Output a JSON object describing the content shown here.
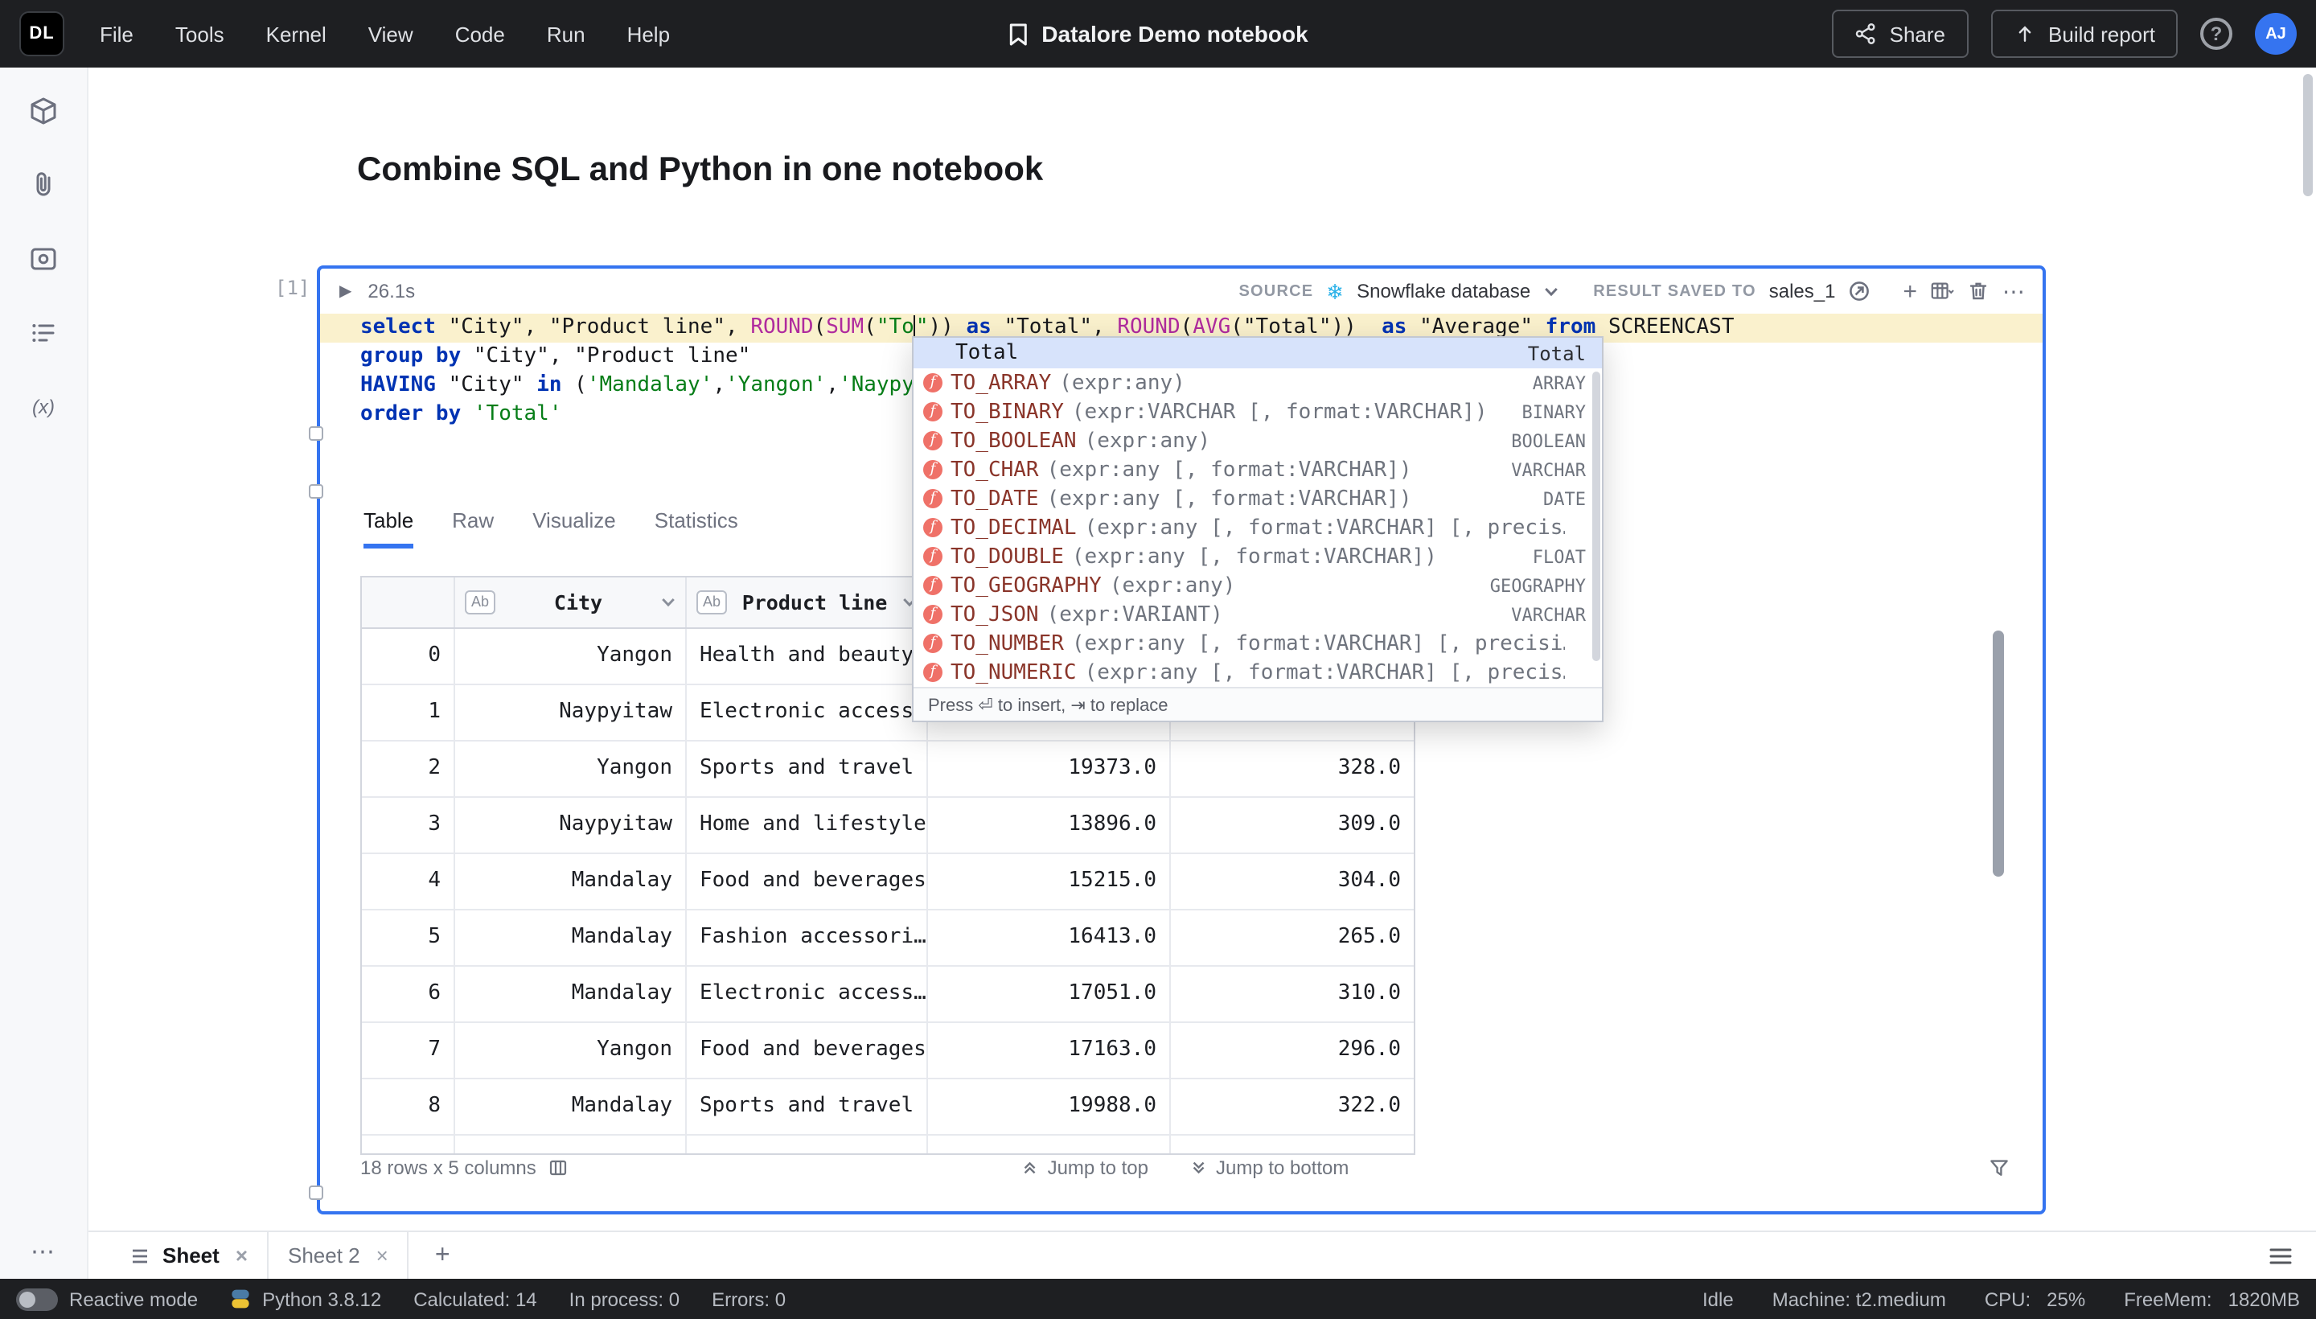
{
  "icons": {
    "play": "▶",
    "snowflake": "❄",
    "kebab": "⋯",
    "plus": "+",
    "help": "?",
    "add_sheet": "+",
    "close": "×"
  },
  "topbar": {
    "logo": "DL",
    "menus": [
      "File",
      "Tools",
      "Kernel",
      "View",
      "Code",
      "Run",
      "Help"
    ],
    "title": "Datalore Demo notebook",
    "share_label": "Share",
    "build_report_label": "Build report",
    "avatar": "AJ"
  },
  "sidebar": {
    "icons": [
      "environment-icon",
      "attachments-icon",
      "integrations-icon",
      "outline-icon",
      "variables-icon"
    ],
    "variables_glyph": "(x)",
    "more_glyph": "⋯"
  },
  "page": {
    "title": "Combine SQL and Python in one notebook"
  },
  "cell": {
    "index_label": "[1]",
    "duration": "26.1s",
    "source_label": "SOURCE",
    "source_value": "Snowflake database",
    "result_label": "RESULT SAVED TO",
    "result_value": "sales_1",
    "code_lines": [
      {
        "highlight": true,
        "tokens": [
          [
            "kw",
            "select "
          ],
          [
            "id",
            "\"City\""
          ],
          [
            "pl",
            ", "
          ],
          [
            "id",
            "\"Product line\""
          ],
          [
            "pl",
            ", "
          ],
          [
            "fn",
            "ROUND"
          ],
          [
            "pl",
            "("
          ],
          [
            "fn",
            "SUM"
          ],
          [
            "pl",
            "("
          ],
          [
            "str",
            "\"To"
          ],
          [
            "caret",
            ""
          ],
          [
            "str",
            "\""
          ],
          [
            "pl",
            ")) "
          ],
          [
            "kw",
            "as "
          ],
          [
            "id",
            "\"Total\""
          ],
          [
            "pl",
            ", "
          ],
          [
            "fn",
            "ROUND"
          ],
          [
            "pl",
            "("
          ],
          [
            "fn",
            "AVG"
          ],
          [
            "pl",
            "("
          ],
          [
            "id",
            "\"Total\""
          ],
          [
            "pl",
            "))  "
          ],
          [
            "kw",
            "as "
          ],
          [
            "id",
            "\"Average\""
          ],
          [
            "pl",
            " "
          ],
          [
            "kw",
            "from "
          ],
          [
            "pl",
            "SCREENCAST"
          ]
        ]
      },
      {
        "highlight": false,
        "tokens": [
          [
            "kw",
            "group by "
          ],
          [
            "id",
            "\"City\""
          ],
          [
            "pl",
            ", "
          ],
          [
            "id",
            "\"Product line\""
          ]
        ]
      },
      {
        "highlight": false,
        "tokens": [
          [
            "kw",
            "HAVING "
          ],
          [
            "id",
            "\"City\" "
          ],
          [
            "kw",
            "in "
          ],
          [
            "pl",
            "("
          ],
          [
            "str",
            "'Mandalay'"
          ],
          [
            "pl",
            ","
          ],
          [
            "str",
            "'Yangon'"
          ],
          [
            "pl",
            ","
          ],
          [
            "str",
            "'Naypyitaw'"
          ],
          [
            "pl",
            ")"
          ]
        ]
      },
      {
        "highlight": false,
        "tokens": [
          [
            "kw",
            "order by "
          ],
          [
            "str",
            "'Total'"
          ]
        ]
      }
    ]
  },
  "autocomplete": {
    "selected_name": "Total",
    "selected_type": "Total",
    "items": [
      {
        "name": "TO_ARRAY",
        "args": "(expr:any)",
        "type": "ARRAY"
      },
      {
        "name": "TO_BINARY",
        "args": "(expr:VARCHAR [, format:VARCHAR])",
        "type": "BINARY"
      },
      {
        "name": "TO_BOOLEAN",
        "args": "(expr:any)",
        "type": "BOOLEAN"
      },
      {
        "name": "TO_CHAR",
        "args": "(expr:any [, format:VARCHAR])",
        "type": "VARCHAR"
      },
      {
        "name": "TO_DATE",
        "args": "(expr:any [, format:VARCHAR])",
        "type": "DATE"
      },
      {
        "name": "TO_DECIMAL",
        "args": "(expr:any [, format:VARCHAR] [, precis…",
        "type": ""
      },
      {
        "name": "TO_DOUBLE",
        "args": "(expr:any [, format:VARCHAR])",
        "type": "FLOAT"
      },
      {
        "name": "TO_GEOGRAPHY",
        "args": "(expr:any)",
        "type": "GEOGRAPHY"
      },
      {
        "name": "TO_JSON",
        "args": "(expr:VARIANT)",
        "type": "VARCHAR"
      },
      {
        "name": "TO_NUMBER",
        "args": "(expr:any [, format:VARCHAR] [, precisi…",
        "type": ""
      },
      {
        "name": "TO_NUMERIC",
        "args": "(expr:any [, format:VARCHAR] [, precis…",
        "type": ""
      }
    ],
    "footer": "Press ⏎ to insert, ⇥ to replace"
  },
  "result_tabs": [
    {
      "label": "Table",
      "active": true
    },
    {
      "label": "Raw",
      "active": false
    },
    {
      "label": "Visualize",
      "active": false
    },
    {
      "label": "Statistics",
      "active": false
    }
  ],
  "table": {
    "columns": [
      {
        "name": "",
        "badge": ""
      },
      {
        "name": "City",
        "badge": "Ab"
      },
      {
        "name": "Product line",
        "badge": "Ab"
      },
      {
        "name": "",
        "badge": ""
      },
      {
        "name": "",
        "badge": ""
      }
    ],
    "rows": [
      [
        "0",
        "Yangon",
        "Health and beauty",
        "",
        ""
      ],
      [
        "1",
        "Naypyitaw",
        "Electronic access…",
        "",
        ""
      ],
      [
        "2",
        "Yangon",
        "Sports and travel",
        "19373.0",
        "328.0"
      ],
      [
        "3",
        "Naypyitaw",
        "Home and lifestyle",
        "13896.0",
        "309.0"
      ],
      [
        "4",
        "Mandalay",
        "Food and beverages",
        "15215.0",
        "304.0"
      ],
      [
        "5",
        "Mandalay",
        "Fashion accessori…",
        "16413.0",
        "265.0"
      ],
      [
        "6",
        "Mandalay",
        "Electronic access…",
        "17051.0",
        "310.0"
      ],
      [
        "7",
        "Yangon",
        "Food and beverages",
        "17163.0",
        "296.0"
      ],
      [
        "8",
        "Mandalay",
        "Sports and travel",
        "19988.0",
        "322.0"
      ]
    ],
    "summary": "18 rows x 5 columns",
    "jump_top": "Jump to top",
    "jump_bottom": "Jump to bottom"
  },
  "sheets": {
    "tabs": [
      {
        "label": "Sheet",
        "active": true
      },
      {
        "label": "Sheet 2",
        "active": false
      }
    ]
  },
  "statusbar": {
    "reactive_label": "Reactive mode",
    "python": "Python 3.8.12",
    "calculated": "Calculated: 14",
    "in_process": "In process: 0",
    "errors": "Errors: 0",
    "idle": "Idle",
    "machine": "Machine: t2.medium",
    "cpu_label": "CPU:",
    "cpu_value": "25%",
    "freemem_label": "FreeMem:",
    "freemem_value": "1820MB"
  }
}
